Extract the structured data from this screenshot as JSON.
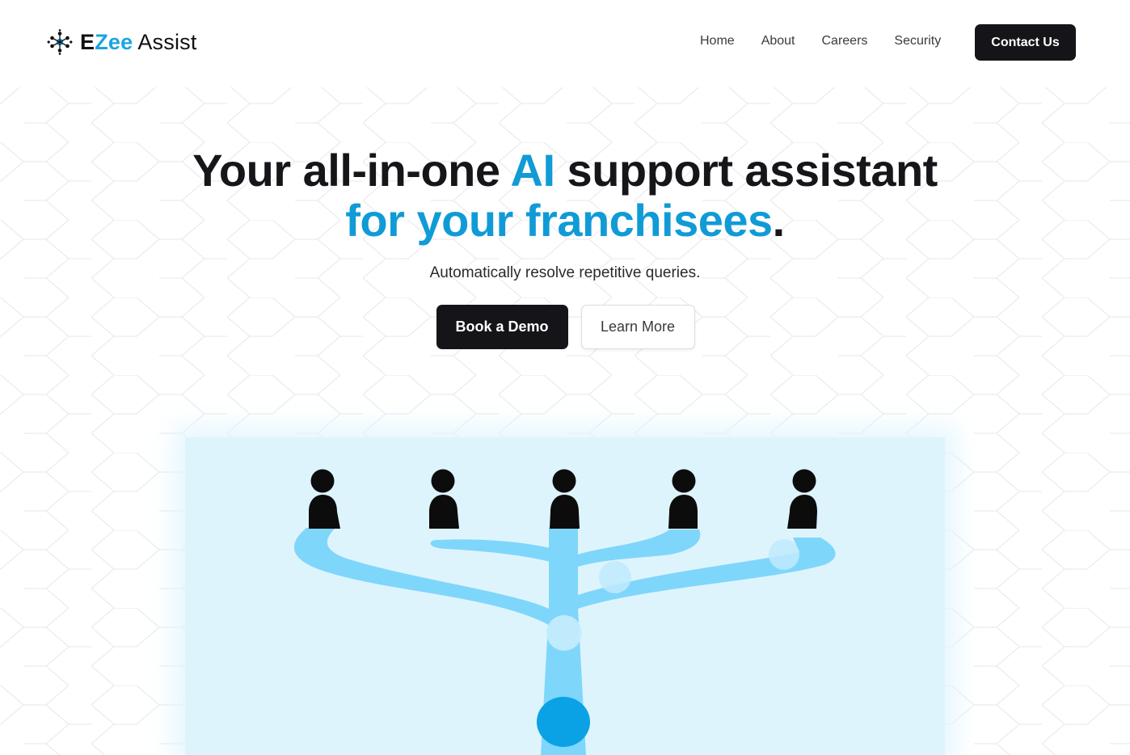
{
  "brand": {
    "name_part1": "E",
    "name_part2": "Zee",
    "name_part3": "Assist",
    "accent_color": "#1ba4e0"
  },
  "nav": {
    "links": [
      "Home",
      "About",
      "Careers",
      "Security"
    ],
    "contact_label": "Contact Us"
  },
  "hero": {
    "headline_part1": "Your all-in-one ",
    "headline_accent1": "AI",
    "headline_part2": " support assistant",
    "headline_accent2": "for your franchisees",
    "headline_end": ".",
    "subtitle": "Automatically resolve repetitive queries.",
    "primary_cta": "Book a Demo",
    "secondary_cta": "Learn More"
  },
  "illustration": {
    "people_count": 5,
    "icons": [
      "person-icon",
      "branching-stream",
      "ai-bubble"
    ],
    "stream_color": "#7fd6fb",
    "bubble_color": "#0aa2e4",
    "background_color": "#def4fd"
  }
}
